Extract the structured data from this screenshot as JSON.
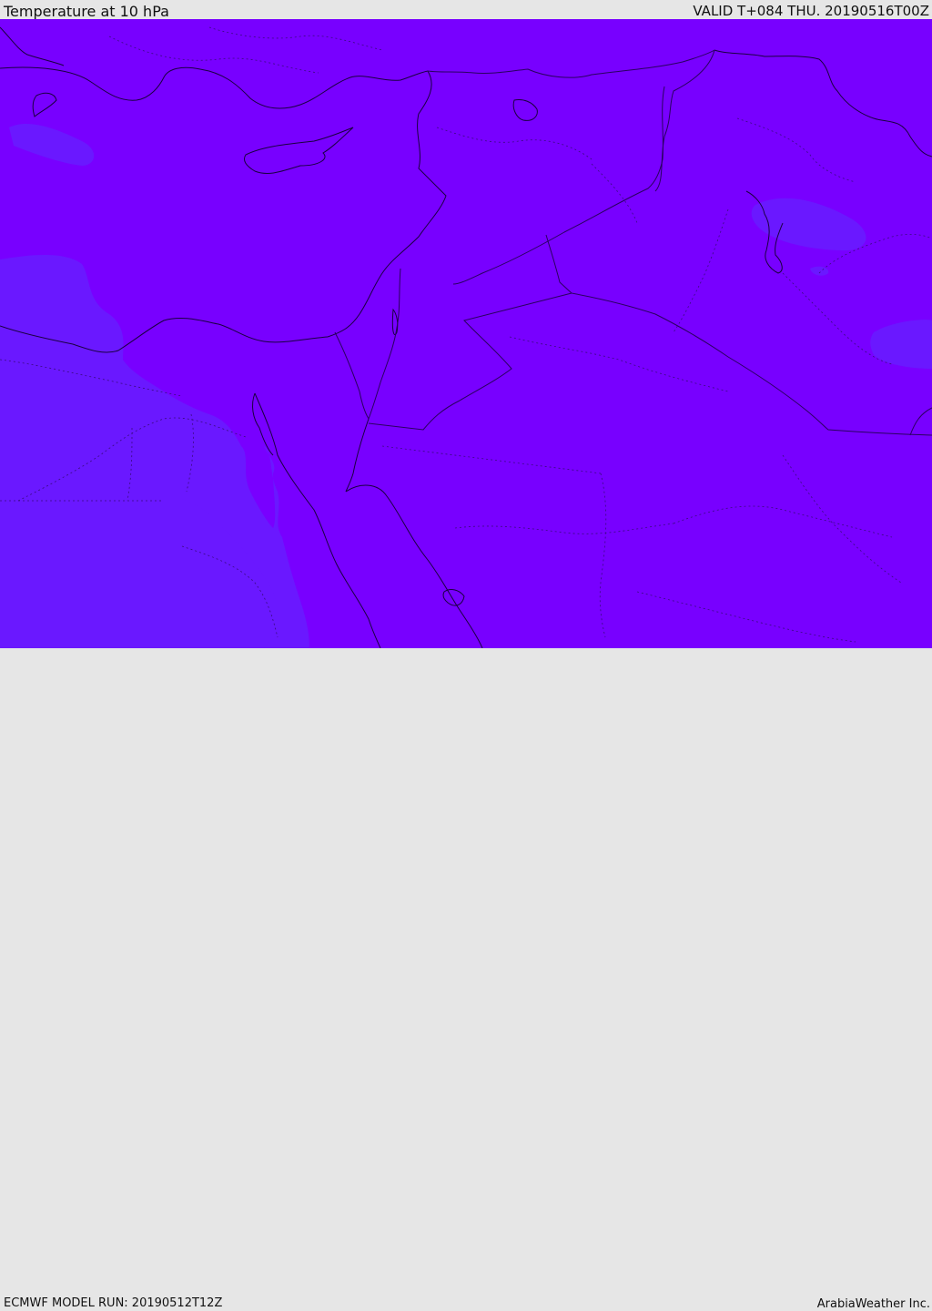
{
  "header": {
    "title": "Temperature at 10 hPa",
    "valid_time": "VALID T+084 THU. 20190516T00Z"
  },
  "footer": {
    "model_run": "ECMWF MODEL RUN: 20190512T12Z",
    "credit": "ArabiaWeather Inc."
  },
  "map": {
    "background_color": "#7800ff",
    "contour_color": "#6a18ff",
    "light_contour_color": "#6a33ff",
    "coast_color": "#1a0040",
    "border_color": "#2a0060"
  }
}
